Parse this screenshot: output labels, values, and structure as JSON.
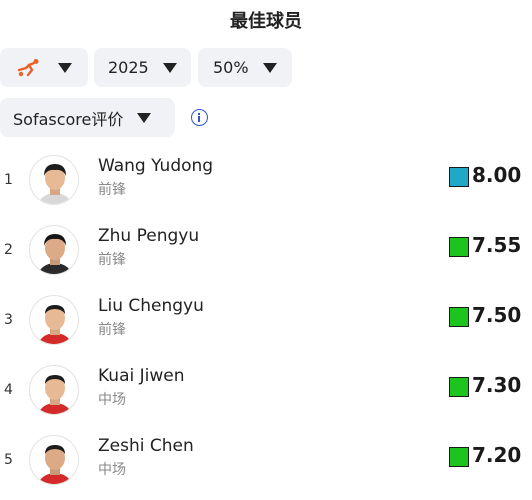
{
  "title": "最佳球员",
  "filters": {
    "sport_icon": "football-kick-icon",
    "year": "2025",
    "percentage": "50%",
    "rating_type": "Sofascore评价"
  },
  "colors": {
    "rating_top": "#20a8c8",
    "rating_good": "#1ec41e",
    "info_accent": "#2f55d4",
    "pill_bg": "#f0f2f5"
  },
  "players": [
    {
      "rank": "1",
      "name": "Wang Yudong",
      "position": "前锋",
      "rating": "8.00",
      "color": "#20a8c8"
    },
    {
      "rank": "2",
      "name": "Zhu Pengyu",
      "position": "前锋",
      "rating": "7.55",
      "color": "#1ec41e"
    },
    {
      "rank": "3",
      "name": "Liu Chengyu",
      "position": "前锋",
      "rating": "7.50",
      "color": "#1ec41e"
    },
    {
      "rank": "4",
      "name": "Kuai Jiwen",
      "position": "中场",
      "rating": "7.30",
      "color": "#1ec41e"
    },
    {
      "rank": "5",
      "name": "Zeshi Chen",
      "position": "中场",
      "rating": "7.20",
      "color": "#1ec41e"
    }
  ]
}
